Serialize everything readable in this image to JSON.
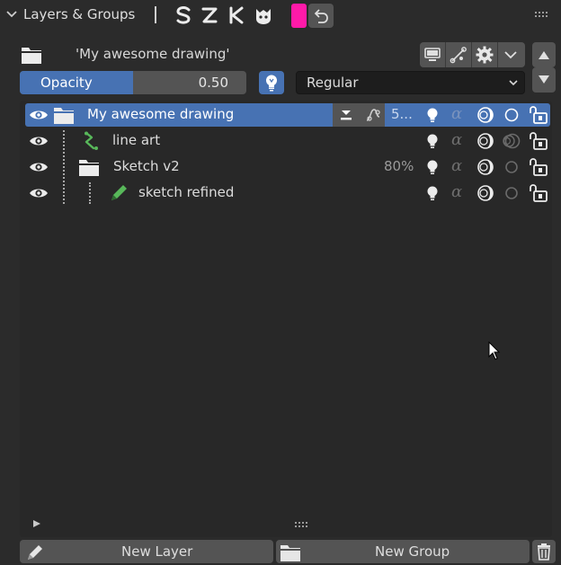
{
  "panel": {
    "title": "Layers & Groups",
    "tool_icons": [
      "curve-s-icon",
      "curve-z-icon",
      "curve-k-icon",
      "creature-icon"
    ],
    "swatch_color": "#ff1aa8",
    "undo_icon": "undo-icon"
  },
  "object": {
    "name": "'My awesome drawing'",
    "icons": [
      "monitor-icon",
      "bone-icon",
      "gear-icon",
      "chevron-down-icon"
    ]
  },
  "controls": {
    "opacity_label": "Opacity",
    "opacity_value": "0.50",
    "opacity_fraction": 0.5,
    "blend_mode": "Regular",
    "bulb_icon": "light-bulb-icon"
  },
  "layers": [
    {
      "label": "My awesome drawing",
      "type": "group",
      "percent": "5...",
      "active": true,
      "depth": 0
    },
    {
      "label": "line art",
      "type": "stroke",
      "percent": "",
      "active": false,
      "depth": 1
    },
    {
      "label": "Sketch v2",
      "type": "group",
      "percent": "80%",
      "active": false,
      "depth": 1
    },
    {
      "label": "sketch refined",
      "type": "pencil",
      "percent": "",
      "active": false,
      "depth": 2
    }
  ],
  "footer": {
    "new_layer": "New Layer",
    "new_group": "New Group"
  },
  "colors": {
    "accent": "#4772b3",
    "button": "#545454",
    "background": "#2b2b2b",
    "green": "#58b85a"
  }
}
